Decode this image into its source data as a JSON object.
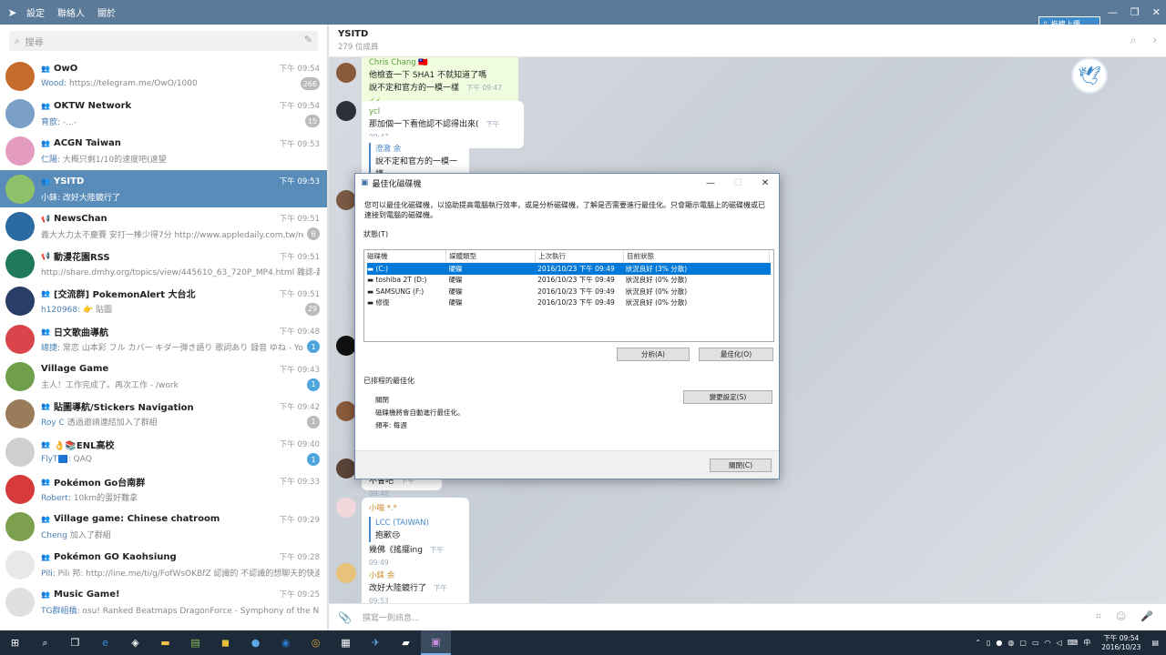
{
  "app": {
    "menu": [
      "設定",
      "聯絡人",
      "關於"
    ],
    "upload_label": "拖拽上傳"
  },
  "search": {
    "placeholder": "搜尋"
  },
  "chats": [
    {
      "name": "OwO",
      "time": "下午 09:54",
      "sender": "Wood:",
      "msg": " https://telegram.me/OwO/1000",
      "badge": "266",
      "badge_color": "gray",
      "avatar_color": "#c76b2c",
      "kind": "group"
    },
    {
      "name": "OKTW Network",
      "time": "下午 09:54",
      "sender": "育歆:",
      "msg": " -...-",
      "badge": "15",
      "badge_color": "gray",
      "avatar_color": "#7aa0c8",
      "kind": "group"
    },
    {
      "name": "ACGN Taiwan",
      "time": "下午 09:53",
      "sender": "仁陽:",
      "msg": " 大概只剩1/10的速度吧(遠望",
      "badge": "",
      "badge_color": "",
      "avatar_color": "#e39bc0",
      "kind": "group"
    },
    {
      "name": "YSITD",
      "time": "下午 09:53",
      "sender": "小銇:",
      "msg": " 改好大陸鏡行了",
      "badge": "",
      "badge_color": "",
      "avatar_color": "#8fc16a",
      "kind": "group",
      "active": true
    },
    {
      "name": "NewsChan",
      "time": "下午 09:51",
      "sender": "",
      "msg": "義大大力太不慶賽 安打一棒少得7分 http://www.appledaily.com.tw/realti...",
      "badge": "6",
      "badge_color": "gray",
      "avatar_color": "#2b6aa3",
      "kind": "channel"
    },
    {
      "name": "動漫花園RSS",
      "time": "下午 09:51",
      "sender": "",
      "msg": "http://share.dmhy.org/topics/view/445610_63_720P_MP4.html 雜誌-超 63 72...",
      "badge": "",
      "badge_color": "",
      "avatar_color": "#1e7a5a",
      "kind": "channel"
    },
    {
      "name": "[交流群] PokemonAlert 大台北",
      "time": "下午 09:51",
      "sender": "h120968:",
      "msg": " 👉 貼圖",
      "badge": "29",
      "badge_color": "gray",
      "avatar_color": "#2a3d66",
      "kind": "group"
    },
    {
      "name": "日文歌曲導航",
      "time": "下午 09:48",
      "sender": "總捷:",
      "msg": " 常恋 山本彩 フル カバー キダー弾き語り 歌詞あり 録音 ゆね - YouTu...",
      "badge": "1",
      "badge_color": "blue",
      "avatar_color": "#d9454a",
      "kind": "group"
    },
    {
      "name": "Village Game",
      "time": "下午 09:43",
      "sender": "",
      "msg": "主人！工作完成了。再次工作 - /work",
      "badge": "1",
      "badge_color": "blue",
      "avatar_color": "#6f9f4a",
      "kind": "none"
    },
    {
      "name": "貼圖導航/Stickers Navigation",
      "time": "下午 09:42",
      "sender": "Roy C",
      "msg": " 透過邀請連結加入了群組",
      "badge": "1",
      "badge_color": "gray",
      "avatar_color": "#9a7b5a",
      "kind": "group"
    },
    {
      "name": "👌📚ENL高校",
      "time": "下午 09:40",
      "sender": "FlyT🟦:",
      "msg": " QAQ",
      "badge": "1",
      "badge_color": "blue",
      "avatar_color": "#cfcfcf",
      "kind": "group"
    },
    {
      "name": "Pokémon Go台南群",
      "time": "下午 09:33",
      "sender": "Robert:",
      "msg": " 10km的蛋好難拿",
      "badge": "",
      "badge_color": "",
      "avatar_color": "#d73a3a",
      "kind": "group"
    },
    {
      "name": "Village game: Chinese chatroom",
      "time": "下午 09:29",
      "sender": "Cheng",
      "msg": " 加入了群組",
      "badge": "",
      "badge_color": "",
      "avatar_color": "#7da04e",
      "kind": "group"
    },
    {
      "name": "Pokémon GO Kaohsiung",
      "time": "下午 09:28",
      "sender": "Pili:",
      "msg": " Pili 邦: http://line.me/ti/g/FofWsOKBfZ 認識的 不認識的想聊天的快進來",
      "badge": "",
      "badge_color": "",
      "avatar_color": "#e8e8e8",
      "kind": "group"
    },
    {
      "name": "Music Game!",
      "time": "下午 09:25",
      "sender": "TG群組橋:",
      "msg": " osu! Ranked Beatmaps DragonForce - Symphony of the Night",
      "badge": "",
      "badge_color": "",
      "avatar_color": "#e0e0e0",
      "kind": "group"
    }
  ],
  "header": {
    "title": "YSITD",
    "subtitle": "279 位成員"
  },
  "messages": {
    "m1_sender": "Chris Chang 🇹🇼",
    "m1_line1": "他檢查一下 SHA1 不就知道了嗎",
    "m1_line2": "說不定和官方的一模一樣",
    "m1_time": "下午 09:47",
    "m2_sender": "ycl",
    "m2_text": "那加個一下看他認不認得出來(",
    "m2_time": "下午 09:47",
    "m3_reply_name": "澄澈 余",
    "m3_reply_text": "說不定和官方的一模一樣",
    "m4_text": "不會吧",
    "m4_time": "下午 09:48",
    "m5_sender": "小喵 *.*",
    "m5_reply_name": "LCC (TAIWAN)",
    "m5_reply_text": "抱歉😢",
    "m5_text": "幾佛《搖擺ing",
    "m5_time": "下午 09:49",
    "m6_sender": "小銇 余",
    "m6_text": "改好大陸鏡行了",
    "m6_time": "下午 09:53"
  },
  "composer": {
    "placeholder": "撰寫一則訊息..."
  },
  "dialog": {
    "title": "最佳化磁碟機",
    "desc": "您可以最佳化磁碟機，以協助提高電腦執行效率，或是分析磁碟機，了解是否需要進行最佳化。只會顯示電腦上的磁碟機或已連接到電腦的磁碟機。",
    "status_label": "狀態(T)",
    "columns": [
      "磁碟機",
      "媒體類型",
      "上次執行",
      "目前狀態"
    ],
    "drives": [
      {
        "name": "(C:)",
        "type": "硬碟",
        "last": "2016/10/23 下午 09:49",
        "status": "狀況良好 (3% 分散)",
        "selected": true
      },
      {
        "name": "toshiba 2T (D:)",
        "type": "硬碟",
        "last": "2016/10/23 下午 09:49",
        "status": "狀況良好 (0% 分散)"
      },
      {
        "name": "SAMSUNG (F:)",
        "type": "硬碟",
        "last": "2016/10/23 下午 09:49",
        "status": "狀況良好 (0% 分散)"
      },
      {
        "name": "修復",
        "type": "硬碟",
        "last": "2016/10/23 下午 09:49",
        "status": "狀況良好 (0% 分散)"
      }
    ],
    "analyze_btn": "分析(A)",
    "optimize_btn": "最佳化(O)",
    "scheduled_label": "已排程的最佳化",
    "sched_state": "關閉",
    "sched_desc": "磁碟機將會自動進行最佳化。",
    "sched_freq": "頻率: 每週",
    "change_btn": "變更設定(S)",
    "close_btn": "關閉(C)"
  },
  "taskbar": {
    "time": "下午 09:54",
    "date": "2016/10/23",
    "ime": "中"
  }
}
